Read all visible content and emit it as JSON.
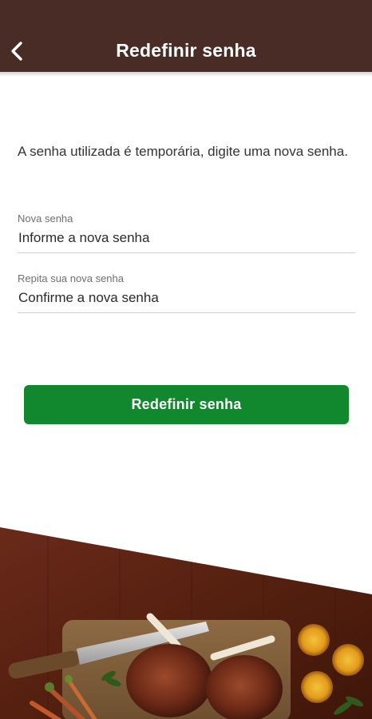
{
  "header": {
    "title": "Redefinir senha",
    "back_icon": "chevron-left-icon",
    "background_color": "#4a2c26"
  },
  "main": {
    "intro_text": "A senha utilizada é temporária, digite uma nova senha.",
    "fields": [
      {
        "label": "Nova senha",
        "placeholder": "Informe a nova senha",
        "value": ""
      },
      {
        "label": "Repita sua nova senha",
        "placeholder": "Confirme a nova senha",
        "value": ""
      }
    ],
    "submit_label": "Redefinir senha",
    "submit_color": "#11882e"
  },
  "footer": {
    "image": "steak-on-cutting-board-with-knife-and-lemons"
  }
}
